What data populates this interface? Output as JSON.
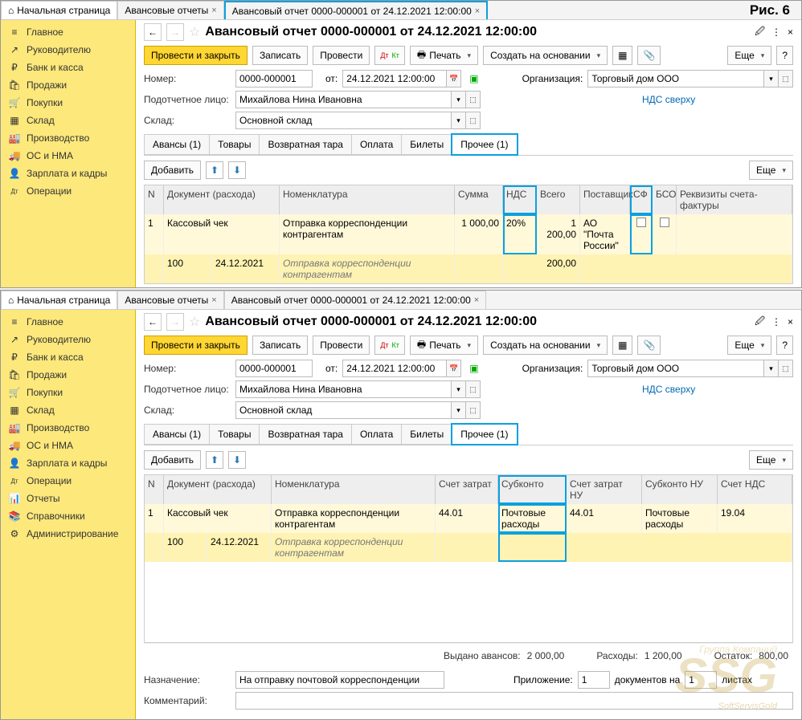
{
  "fig_label": "Рис. 6",
  "tabs": {
    "home": "Начальная страница",
    "list": "Авансовые отчеты",
    "doc": "Авансовый отчет 0000-000001 от 24.12.2021 12:00:00"
  },
  "sidebar": {
    "items": [
      {
        "icon": "≡",
        "label": "Главное"
      },
      {
        "icon": "↗",
        "label": "Руководителю"
      },
      {
        "icon": "₽",
        "label": "Банк и касса"
      },
      {
        "icon": "🛍",
        "label": "Продажи"
      },
      {
        "icon": "🛒",
        "label": "Покупки"
      },
      {
        "icon": "▦",
        "label": "Склад"
      },
      {
        "icon": "🏭",
        "label": "Производство"
      },
      {
        "icon": "🚚",
        "label": "ОС и НМА"
      },
      {
        "icon": "👤",
        "label": "Зарплата и кадры"
      },
      {
        "icon": "Дт Кт",
        "label": "Операции"
      },
      {
        "icon": "📊",
        "label": "Отчеты"
      },
      {
        "icon": "📚",
        "label": "Справочники"
      },
      {
        "icon": "⚙",
        "label": "Администрирование"
      }
    ]
  },
  "doc_title": "Авансовый отчет 0000-000001 от 24.12.2021 12:00:00",
  "toolbar": {
    "post_close": "Провести и закрыть",
    "save": "Записать",
    "post": "Провести",
    "dtkt": "Дт Кт",
    "print": "Печать",
    "create_based": "Создать на основании",
    "more": "Еще"
  },
  "form": {
    "number_lbl": "Номер:",
    "number": "0000-000001",
    "from": "от:",
    "date": "24.12.2021 12:00:00",
    "org_lbl": "Организация:",
    "org": "Торговый дом ООО",
    "person_lbl": "Подотчетное лицо:",
    "person": "Михайлова Нина Ивановна",
    "vat_link": "НДС сверху",
    "wh_lbl": "Склад:",
    "wh": "Основной склад"
  },
  "doc_tabs": [
    "Авансы (1)",
    "Товары",
    "Возвратная тара",
    "Оплата",
    "Билеты",
    "Прочее (1)"
  ],
  "tbtool": {
    "add": "Добавить",
    "more": "Еще"
  },
  "grid1": {
    "heads": [
      "N",
      "Документ (расхода)",
      "Номенклатура",
      "Сумма",
      "НДС",
      "Всего",
      "Поставщик",
      "СФ",
      "БСО",
      "Реквизиты счета-фактуры"
    ],
    "row1": {
      "n": "1",
      "doc": "Кассовый чек",
      "nom": "Отправка корреспонденции контрагентам",
      "sum": "1 000,00",
      "vat": "20%",
      "total": "1 200,00",
      "supplier": "АО \"Почта России\""
    },
    "row2": {
      "doc_n": "100",
      "doc_d": "24.12.2021",
      "nom": "Отправка корреспонденции контрагентам",
      "sum": "200,00"
    }
  },
  "grid2": {
    "heads": [
      "N",
      "Документ (расхода)",
      "Номенклатура",
      "Счет затрат",
      "Субконто",
      "Счет затрат НУ",
      "Субконто НУ",
      "Счет НДС"
    ],
    "row1": {
      "n": "1",
      "doc": "Кассовый чек",
      "nom": "Отправка корреспонденции контрагентам",
      "acc": "44.01",
      "sub": "Почтовые расходы",
      "accnu": "44.01",
      "subnu": "Почтовые расходы",
      "vacc": "19.04"
    },
    "row2": {
      "doc_n": "100",
      "doc_d": "24.12.2021",
      "nom": "Отправка корреспонденции контрагентам"
    }
  },
  "totals": {
    "adv_lbl": "Выдано авансов:",
    "adv": "2 000,00",
    "exp_lbl": "Расходы:",
    "exp": "1 200,00",
    "rem_lbl": "Остаток:",
    "rem": "800,00"
  },
  "bottom": {
    "purpose_lbl": "Назначение:",
    "purpose": "На отправку почтовой корреспонденции",
    "attach_lbl": "Приложение:",
    "attach": "1",
    "docs_on": "документов на",
    "sheets": "1",
    "sheets_lbl": "листах",
    "comment_lbl": "Комментарий:"
  },
  "wm": {
    "group": "Группа Компаний",
    "ssg": "SSG",
    "site": "SoftServisGold"
  }
}
